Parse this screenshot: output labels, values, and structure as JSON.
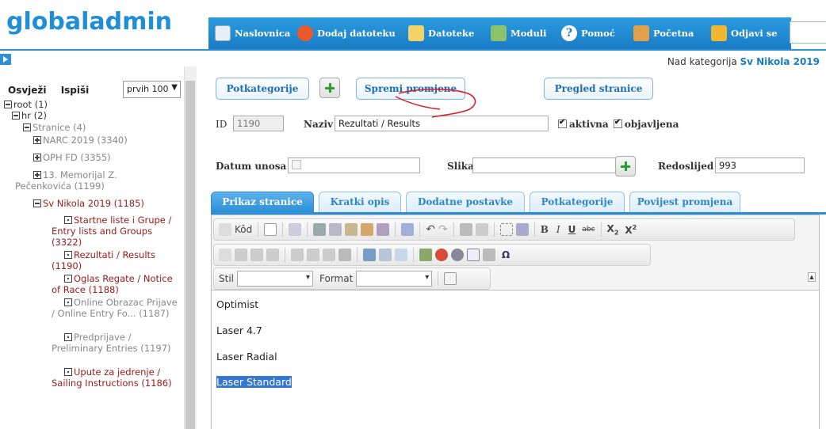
{
  "app": {
    "logo": "globaladmin"
  },
  "nav": {
    "items": [
      {
        "label": "Naslovnica",
        "icon": "document-icon"
      },
      {
        "label": "Dodaj datoteku",
        "icon": "add-file-icon"
      },
      {
        "label": "Datoteke",
        "icon": "files-icon"
      },
      {
        "label": "Moduli",
        "icon": "modules-icon"
      },
      {
        "label": "Pomoć",
        "icon": "help-icon"
      },
      {
        "label": "Početna",
        "icon": "home-icon"
      },
      {
        "label": "Odjavi se",
        "icon": "logout-icon"
      }
    ]
  },
  "left": {
    "refresh": "Osvježi",
    "print": "Ispiši",
    "select_value": "prvih 100",
    "tree": [
      {
        "label": "root (1)",
        "style": "dark",
        "box": "minus"
      },
      {
        "label": "hr (2)",
        "style": "dark",
        "box": "minus"
      },
      {
        "label": "Stranice (4)",
        "style": "gray",
        "box": "minus"
      },
      {
        "label": "NARC 2019 (3340)",
        "style": "gray",
        "box": "plus"
      },
      {
        "label": "OPH FD (3355)",
        "style": "gray",
        "box": "plus"
      },
      {
        "label": "13. Memorijal Z. Pečenkovića (1199)",
        "style": "gray",
        "box": "plus"
      },
      {
        "label": "Sv Nikola 2019 (1185)",
        "style": "red",
        "box": "minus"
      },
      {
        "label": "Startne liste i Grupe / Entry lists and Groups (3322)",
        "style": "red",
        "box": "dot"
      },
      {
        "label": "Rezultati / Results (1190)",
        "style": "red",
        "box": "dot"
      },
      {
        "label": "Oglas Regate / Notice of Race (1188)",
        "style": "red",
        "box": "dot"
      },
      {
        "label": "Online Obrazac Prijave / Online Entry Fo... (1187)",
        "style": "gray",
        "box": "dot"
      },
      {
        "label": "Predprijave / Preliminary Entries (1197)",
        "style": "gray",
        "box": "dot"
      },
      {
        "label": "Upute za jedrenje / Sailing Instructions (1186)",
        "style": "red",
        "box": "dot"
      }
    ]
  },
  "main": {
    "parent_label": "Nad kategorija",
    "parent_value": "Sv Nikola 2019",
    "btn_subcategories": "Potkategorije",
    "btn_save": "Spremi promjene",
    "btn_preview": "Pregled stranice",
    "id_label": "ID",
    "id_value": "1190",
    "name_label": "Naziv",
    "name_value": "Rezultati / Results",
    "active_label": "aktivna",
    "published_label": "objavljena",
    "date_label": "Datum unosa",
    "image_label": "Slika",
    "order_label": "Redoslijed",
    "order_value": "993",
    "tabs": [
      "Prikaz stranice",
      "Kratki opis",
      "Dodatne postavke",
      "Potkategorije",
      "Povijest promjena"
    ]
  },
  "editor": {
    "source_label": "Kôd",
    "style_label": "Stil",
    "format_label": "Format",
    "paragraphs": [
      "Optimist",
      "Laser 4.7",
      "Laser Radial",
      "Laser Standard"
    ]
  }
}
